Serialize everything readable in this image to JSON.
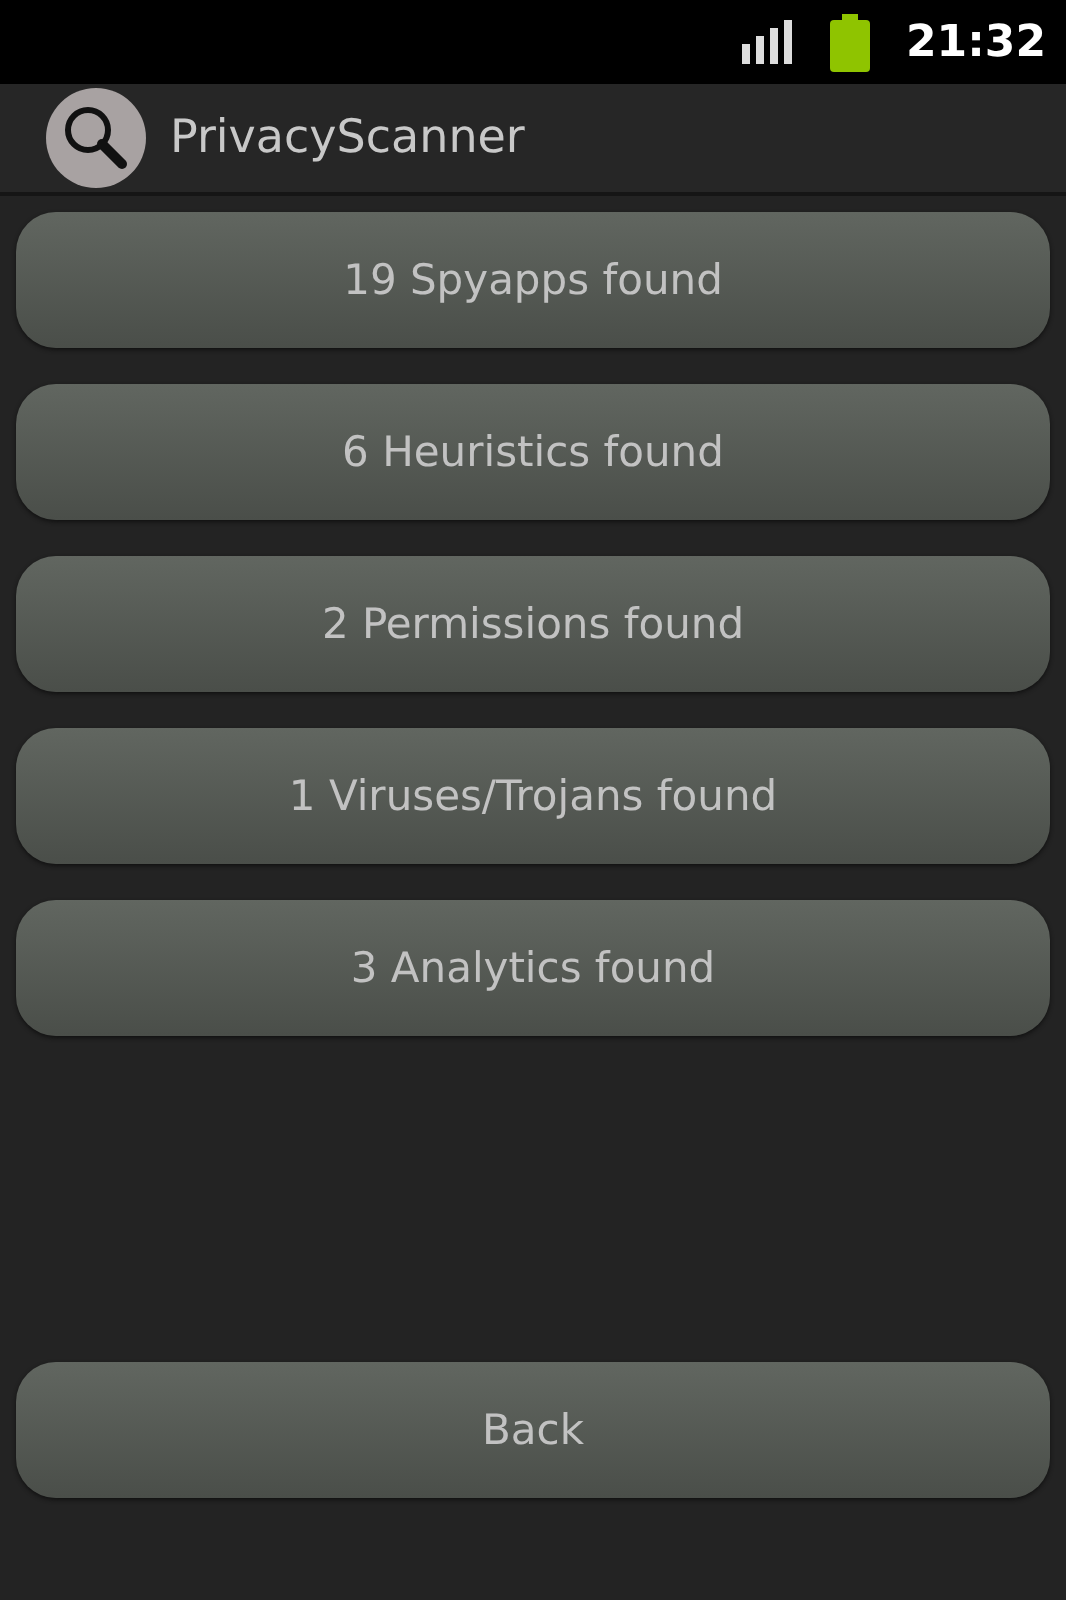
{
  "status_bar": {
    "time": "21:32"
  },
  "action_bar": {
    "title": "PrivacyScanner"
  },
  "results": [
    {
      "label": "19 Spyapps found"
    },
    {
      "label": "6 Heuristics found"
    },
    {
      "label": "2 Permissions found"
    },
    {
      "label": "1 Viruses/Trojans found"
    },
    {
      "label": "3 Analytics found"
    }
  ],
  "back_button": {
    "label": "Back"
  }
}
